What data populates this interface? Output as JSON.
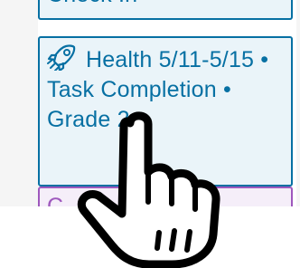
{
  "calendar": {
    "previous_event": {
      "title": "Check In"
    },
    "current_event": {
      "icon": "rocket-icon",
      "title": "Health 5/11-5/15 • Task Completion • Grade 2"
    },
    "next_event": {
      "title": "C"
    }
  },
  "overlay": {
    "icon": "pointing-hand-cursor-icon"
  },
  "colors": {
    "event_blue": "#0770a3",
    "event_blue_bg": "#eaf4f9",
    "event_purple": "#9e58bd",
    "gutter_gray": "#f5f5f5"
  }
}
